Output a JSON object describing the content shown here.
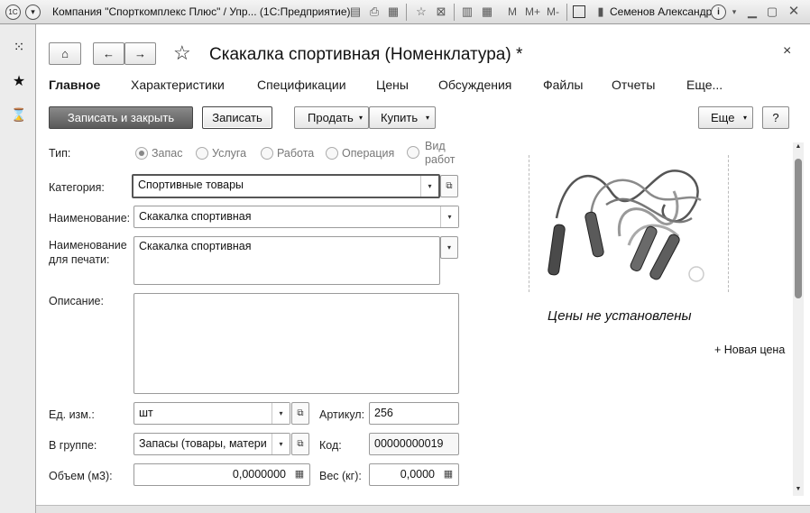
{
  "window": {
    "title": "Компания \"Спорткомплекс Плюс\" / Упр... (1С:Предприятие)",
    "memory_labels": [
      "M",
      "M+",
      "M-"
    ],
    "user": "Семенов Александр"
  },
  "form": {
    "title": "Скакалка спортивная (Номенклатура) *",
    "tabs": [
      "Главное",
      "Характеристики",
      "Спецификации",
      "Цены",
      "Обсуждения",
      "Файлы",
      "Отчеты",
      "Еще..."
    ],
    "buttons": {
      "save_close": "Записать и закрыть",
      "save": "Записать",
      "sell": "Продать",
      "buy": "Купить",
      "more": "Еще",
      "help": "?"
    },
    "type": {
      "label": "Тип:",
      "options": [
        "Запас",
        "Услуга",
        "Работа",
        "Операция",
        "Вид работ"
      ],
      "selected": "Запас"
    },
    "category": {
      "label": "Категория:",
      "value": "Спортивные товары"
    },
    "name": {
      "label": "Наименование:",
      "value": "Скакалка спортивная"
    },
    "print_name": {
      "label": "Наименование для печати:",
      "value": "Скакалка спортивная"
    },
    "description": {
      "label": "Описание:",
      "value": ""
    },
    "unit": {
      "label": "Ед. изм.:",
      "value": "шт"
    },
    "article": {
      "label": "Артикул:",
      "value": "256"
    },
    "group": {
      "label": "В группе:",
      "value": "Запасы (товары, матери"
    },
    "code": {
      "label": "Код:",
      "value": "00000000019"
    },
    "volume": {
      "label": "Объем (м3):",
      "value": "0,0000000"
    },
    "weight": {
      "label": "Вес (кг):",
      "value": "0,0000"
    },
    "prices": {
      "status": "Цены не установлены",
      "new_price": "+ Новая цена"
    }
  }
}
